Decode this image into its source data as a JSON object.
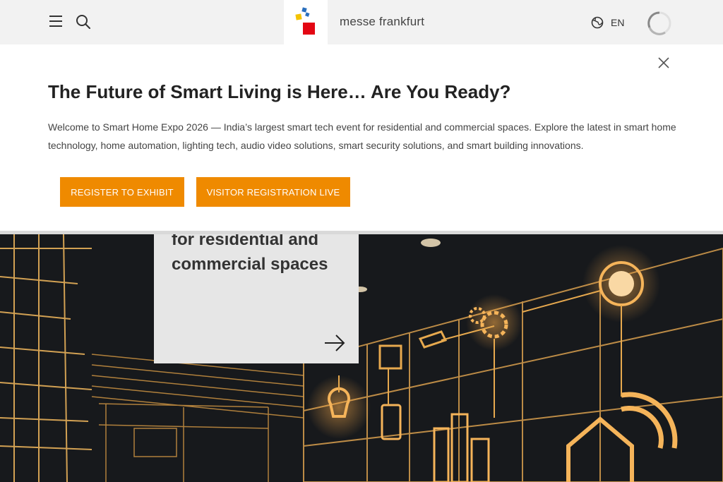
{
  "header": {
    "brand_name": "messe frankfurt",
    "language": "EN"
  },
  "banner": {
    "title": "The Future of Smart Living is Here… Are You Ready?",
    "text": "Welcome to Smart Home Expo 2026 — India’s largest smart tech event for residential and commercial spaces. Explore the latest in smart home technology, home automation, lighting tech, audio video solutions, smart security solutions, and smart building innovations.",
    "buttons": {
      "exhibit": "REGISTER TO EXHIBIT",
      "visitor": "VISITOR REGISTRATION LIVE"
    }
  },
  "hero": {
    "card_title": "for residential and commercial spaces"
  },
  "icons": [
    "menu-icon",
    "search-icon",
    "globe-icon",
    "close-icon",
    "arrow-right-icon"
  ],
  "colors": {
    "accent": "#ef8a00",
    "header_bg": "#f2f2f2",
    "hero_glow": "#f5a94a",
    "logo_blue": "#2a6fbd",
    "logo_yellow": "#f4c300",
    "logo_red": "#e30613"
  }
}
